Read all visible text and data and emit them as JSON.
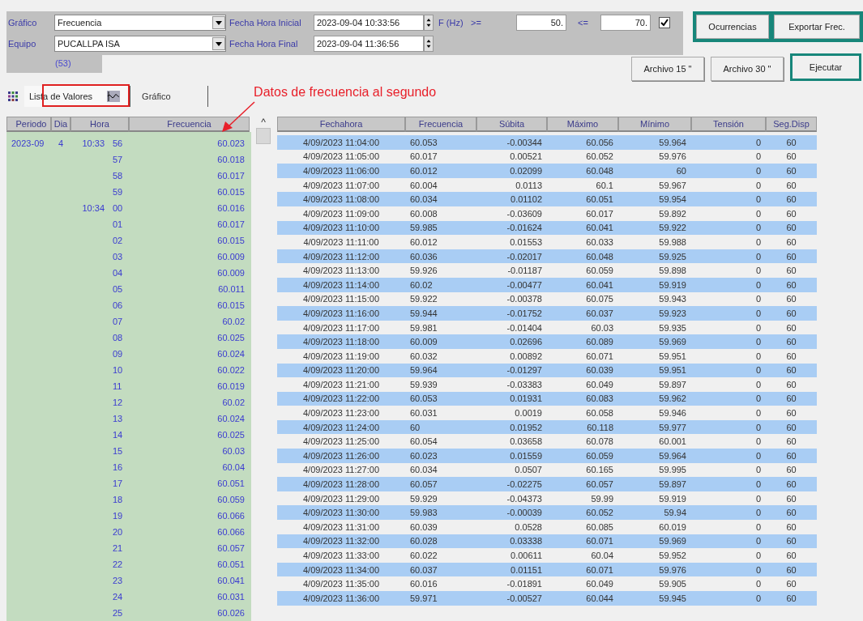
{
  "form": {
    "grafico_label": "Gráfico",
    "grafico_value": "Frecuencia",
    "equipo_label": "Equipo",
    "equipo_value": "PUCALLPA ISA",
    "inicio_label": "Fecha Hora Inicial",
    "inicio_value": "2023-09-04 10:33:56",
    "fin_label": "Fecha Hora Final",
    "fin_value": "2023-09-04 11:36:56",
    "f_label": "F (Hz)",
    "ge_label": ">=",
    "ge_value": "50.",
    "le_label": "<=",
    "le_value": "70.",
    "filter_checked": true,
    "count": "(53)"
  },
  "buttons": {
    "ocurrencias": "Ocurrencias",
    "exportar": "Exportar Frec.",
    "archivo15": "Archivo 15 \"",
    "archivo30": "Archivo 30 \"",
    "ejecutar": "Ejecutar"
  },
  "tabs": [
    {
      "label": "Lista de Valores",
      "selected": true
    },
    {
      "label": "Gráfico",
      "selected": false
    }
  ],
  "annotation": "Datos de frecuencia al segundo",
  "left_table": {
    "columns": [
      "Periodo",
      "Dia",
      "Hora",
      "Frecuencia"
    ],
    "scroll_up": "^",
    "rows": [
      {
        "periodo": "2023-09",
        "dia": "4",
        "hora": "10:33",
        "segundo": "56",
        "frecuencia": "60.023"
      },
      {
        "segundo": "57",
        "frecuencia": "60.018"
      },
      {
        "segundo": "58",
        "frecuencia": "60.017"
      },
      {
        "segundo": "59",
        "frecuencia": "60.015"
      },
      {
        "hora": "10:34",
        "segundo": "00",
        "frecuencia": "60.016"
      },
      {
        "segundo": "01",
        "frecuencia": "60.017"
      },
      {
        "segundo": "02",
        "frecuencia": "60.015"
      },
      {
        "segundo": "03",
        "frecuencia": "60.009"
      },
      {
        "segundo": "04",
        "frecuencia": "60.009"
      },
      {
        "segundo": "05",
        "frecuencia": "60.011"
      },
      {
        "segundo": "06",
        "frecuencia": "60.015"
      },
      {
        "segundo": "07",
        "frecuencia": "60.02"
      },
      {
        "segundo": "08",
        "frecuencia": "60.025"
      },
      {
        "segundo": "09",
        "frecuencia": "60.024"
      },
      {
        "segundo": "10",
        "frecuencia": "60.022"
      },
      {
        "segundo": "11",
        "frecuencia": "60.019"
      },
      {
        "segundo": "12",
        "frecuencia": "60.02"
      },
      {
        "segundo": "13",
        "frecuencia": "60.024"
      },
      {
        "segundo": "14",
        "frecuencia": "60.025"
      },
      {
        "segundo": "15",
        "frecuencia": "60.03"
      },
      {
        "segundo": "16",
        "frecuencia": "60.04"
      },
      {
        "segundo": "17",
        "frecuencia": "60.051"
      },
      {
        "segundo": "18",
        "frecuencia": "60.059"
      },
      {
        "segundo": "19",
        "frecuencia": "60.066"
      },
      {
        "segundo": "20",
        "frecuencia": "60.066"
      },
      {
        "segundo": "21",
        "frecuencia": "60.057"
      },
      {
        "segundo": "22",
        "frecuencia": "60.051"
      },
      {
        "segundo": "23",
        "frecuencia": "60.041"
      },
      {
        "segundo": "24",
        "frecuencia": "60.031"
      },
      {
        "segundo": "25",
        "frecuencia": "60.026"
      }
    ]
  },
  "right_table": {
    "columns": [
      "Fechahora",
      "Frecuencia",
      "Súbita",
      "Máximo",
      "Mínimo",
      "Tensión",
      "Seg.Disp"
    ],
    "rows": [
      [
        "4/09/2023 11:04:00",
        "60.053",
        "-0.00344",
        "60.056",
        "59.964",
        "0",
        "60"
      ],
      [
        "4/09/2023 11:05:00",
        "60.017",
        "0.00521",
        "60.052",
        "59.976",
        "0",
        "60"
      ],
      [
        "4/09/2023 11:06:00",
        "60.012",
        "0.02099",
        "60.048",
        "60",
        "0",
        "60"
      ],
      [
        "4/09/2023 11:07:00",
        "60.004",
        "0.0113",
        "60.1",
        "59.967",
        "0",
        "60"
      ],
      [
        "4/09/2023 11:08:00",
        "60.034",
        "0.01102",
        "60.051",
        "59.954",
        "0",
        "60"
      ],
      [
        "4/09/2023 11:09:00",
        "60.008",
        "-0.03609",
        "60.017",
        "59.892",
        "0",
        "60"
      ],
      [
        "4/09/2023 11:10:00",
        "59.985",
        "-0.01624",
        "60.041",
        "59.922",
        "0",
        "60"
      ],
      [
        "4/09/2023 11:11:00",
        "60.012",
        "0.01553",
        "60.033",
        "59.988",
        "0",
        "60"
      ],
      [
        "4/09/2023 11:12:00",
        "60.036",
        "-0.02017",
        "60.048",
        "59.925",
        "0",
        "60"
      ],
      [
        "4/09/2023 11:13:00",
        "59.926",
        "-0.01187",
        "60.059",
        "59.898",
        "0",
        "60"
      ],
      [
        "4/09/2023 11:14:00",
        "60.02",
        "-0.00477",
        "60.041",
        "59.919",
        "0",
        "60"
      ],
      [
        "4/09/2023 11:15:00",
        "59.922",
        "-0.00378",
        "60.075",
        "59.943",
        "0",
        "60"
      ],
      [
        "4/09/2023 11:16:00",
        "59.944",
        "-0.01752",
        "60.037",
        "59.923",
        "0",
        "60"
      ],
      [
        "4/09/2023 11:17:00",
        "59.981",
        "-0.01404",
        "60.03",
        "59.935",
        "0",
        "60"
      ],
      [
        "4/09/2023 11:18:00",
        "60.009",
        "0.02696",
        "60.089",
        "59.969",
        "0",
        "60"
      ],
      [
        "4/09/2023 11:19:00",
        "60.032",
        "0.00892",
        "60.071",
        "59.951",
        "0",
        "60"
      ],
      [
        "4/09/2023 11:20:00",
        "59.964",
        "-0.01297",
        "60.039",
        "59.951",
        "0",
        "60"
      ],
      [
        "4/09/2023 11:21:00",
        "59.939",
        "-0.03383",
        "60.049",
        "59.897",
        "0",
        "60"
      ],
      [
        "4/09/2023 11:22:00",
        "60.053",
        "0.01931",
        "60.083",
        "59.962",
        "0",
        "60"
      ],
      [
        "4/09/2023 11:23:00",
        "60.031",
        "0.0019",
        "60.058",
        "59.946",
        "0",
        "60"
      ],
      [
        "4/09/2023 11:24:00",
        "60",
        "0.01952",
        "60.118",
        "59.977",
        "0",
        "60"
      ],
      [
        "4/09/2023 11:25:00",
        "60.054",
        "0.03658",
        "60.078",
        "60.001",
        "0",
        "60"
      ],
      [
        "4/09/2023 11:26:00",
        "60.023",
        "0.01559",
        "60.059",
        "59.964",
        "0",
        "60"
      ],
      [
        "4/09/2023 11:27:00",
        "60.034",
        "0.0507",
        "60.165",
        "59.995",
        "0",
        "60"
      ],
      [
        "4/09/2023 11:28:00",
        "60.057",
        "-0.02275",
        "60.057",
        "59.897",
        "0",
        "60"
      ],
      [
        "4/09/2023 11:29:00",
        "59.929",
        "-0.04373",
        "59.99",
        "59.919",
        "0",
        "60"
      ],
      [
        "4/09/2023 11:30:00",
        "59.983",
        "-0.00039",
        "60.052",
        "59.94",
        "0",
        "60"
      ],
      [
        "4/09/2023 11:31:00",
        "60.039",
        "0.0528",
        "60.085",
        "60.019",
        "0",
        "60"
      ],
      [
        "4/09/2023 11:32:00",
        "60.028",
        "0.03338",
        "60.071",
        "59.969",
        "0",
        "60"
      ],
      [
        "4/09/2023 11:33:00",
        "60.022",
        "0.00611",
        "60.04",
        "59.952",
        "0",
        "60"
      ],
      [
        "4/09/2023 11:34:00",
        "60.037",
        "0.01151",
        "60.071",
        "59.976",
        "0",
        "60"
      ],
      [
        "4/09/2023 11:35:00",
        "60.016",
        "-0.01891",
        "60.049",
        "59.905",
        "0",
        "60"
      ],
      [
        "4/09/2023 11:36:00",
        "59.971",
        "-0.00527",
        "60.044",
        "59.945",
        "0",
        "60"
      ]
    ]
  }
}
